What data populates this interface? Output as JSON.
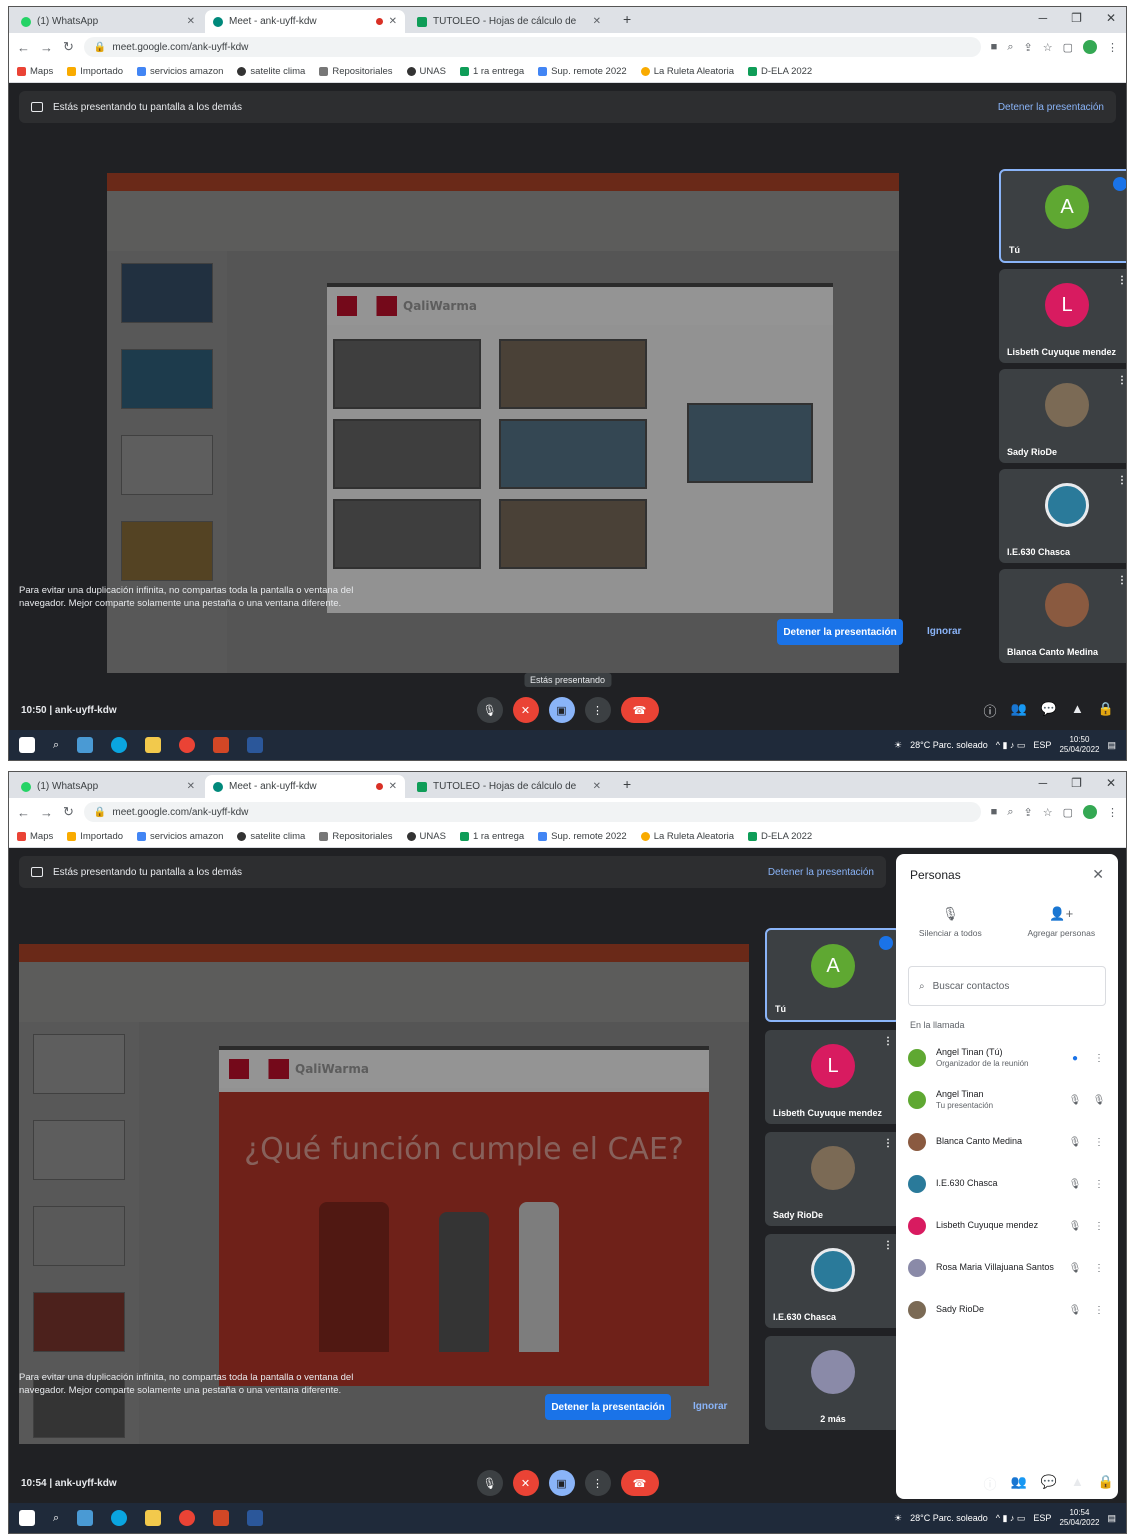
{
  "browser": {
    "tabs": [
      {
        "label": "(1) WhatsApp"
      },
      {
        "label": "Meet - ank-uyff-kdw"
      },
      {
        "label": "TUTOLEO - Hojas de cálculo de"
      }
    ],
    "url": "meet.google.com/ank-uyff-kdw",
    "bookmarks": [
      "Maps",
      "Importado",
      "servicios amazon",
      "satelite clima",
      "Repositoriales",
      "UNAS",
      "1 ra entrega",
      "Sup. remote 2022",
      "La Ruleta Aleatoria",
      "D-ELA 2022"
    ]
  },
  "meet": {
    "presenting_banner": "Estás presentando tu pantalla a los demás",
    "stop_presenting_link": "Detener la presentación",
    "notice": "Para evitar una duplicación infinita, no compartas toda la pantalla o ventana del navegador. Mejor comparte solamente una pestaña o una ventana diferente.",
    "stop_button": "Detener la presentación",
    "ignore_button": "Ignorar",
    "meeting_code": "10:50 | ank-uyff-kdw",
    "meeting_code_2": "10:54 | ank-uyff-kdw",
    "tooltip": "Estás presentando",
    "slide_logo": "QaliWarma",
    "slide_question": "¿Qué función cumple el CAE?"
  },
  "participants": [
    {
      "initial": "A",
      "name": "Tú",
      "color": "#5fa832"
    },
    {
      "initial": "L",
      "name": "Lisbeth Cuyuque mendez",
      "color": "#d81b60"
    },
    {
      "initial": "",
      "name": "Sady RioDe",
      "color": "#7b6a55"
    },
    {
      "initial": "",
      "name": "I.E.630 Chasca",
      "color": "#2a7a9a"
    },
    {
      "initial": "",
      "name": "Blanca Canto Medina",
      "color": "#8a5a40"
    }
  ],
  "tile_others": "2 más",
  "people_panel": {
    "title": "Personas",
    "mute_all": "Silenciar a todos",
    "add_people": "Agregar personas",
    "search_placeholder": "Buscar contactos",
    "section": "En la llamada",
    "rows": [
      {
        "name": "Angel Tinan (Tú)",
        "sub": "Organizador de la reunión",
        "color": "#5fa832"
      },
      {
        "name": "Angel Tinan",
        "sub": "Tu presentación",
        "color": "#5fa832"
      },
      {
        "name": "Blanca Canto Medina",
        "sub": "",
        "color": "#8a5a40"
      },
      {
        "name": "I.E.630 Chasca",
        "sub": "",
        "color": "#2a7a9a"
      },
      {
        "name": "Lisbeth Cuyuque mendez",
        "sub": "",
        "color": "#d81b60"
      },
      {
        "name": "Rosa Maria Villajuana Santos",
        "sub": "",
        "color": "#8a8aa8"
      },
      {
        "name": "Sady RioDe",
        "sub": "",
        "color": "#7b6a55"
      }
    ]
  },
  "taskbar": {
    "weather": "28°C  Parc. soleado",
    "time_1": "10:50",
    "time_2": "10:54",
    "date": "25/04/2022",
    "lang": "ESP"
  }
}
